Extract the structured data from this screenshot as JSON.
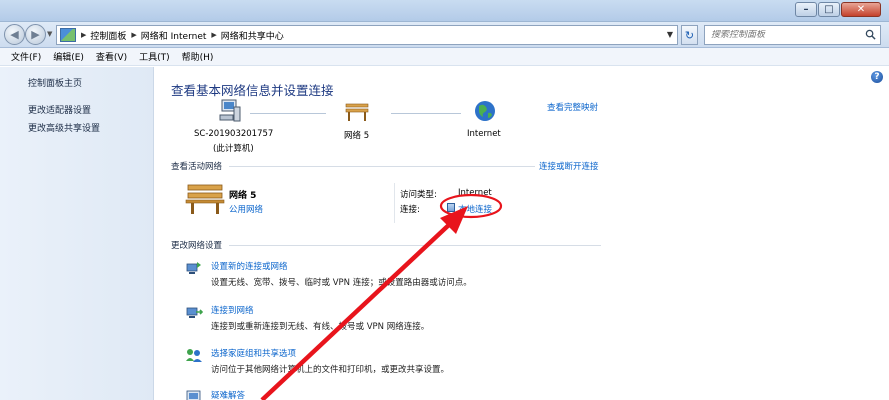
{
  "window": {
    "buttons": [
      "minimize",
      "maximize",
      "close"
    ]
  },
  "addressbar": {
    "crumbs": [
      "控制面板",
      "网络和 Internet",
      "网络和共享中心"
    ],
    "search_placeholder": "搜索控制面板"
  },
  "menu": [
    "文件(F)",
    "编辑(E)",
    "查看(V)",
    "工具(T)",
    "帮助(H)"
  ],
  "sidebar": {
    "home": "控制面板主页",
    "links": [
      "更改适配器设置",
      "更改高级共享设置"
    ]
  },
  "main": {
    "title": "查看基本网络信息并设置连接",
    "full_map_link": "查看完整映射",
    "map": {
      "computer_name": "SC-201903201757",
      "computer_sub": "(此计算机)",
      "network_name": "网络  5",
      "internet": "Internet"
    },
    "active_section": {
      "heading": "查看活动网络",
      "connect_link": "连接或断开连接",
      "network_name": "网络  5",
      "network_type": "公用网络",
      "access_type_label": "访问类型:",
      "access_type_value": "Internet",
      "connections_label": "连接:",
      "connection_link": "本地连接"
    },
    "change_section": {
      "heading": "更改网络设置",
      "tasks": [
        {
          "title": "设置新的连接或网络",
          "desc": "设置无线、宽带、拨号、临时或 VPN 连接；或设置路由器或访问点。"
        },
        {
          "title": "连接到网络",
          "desc": "连接到或重新连接到无线、有线、拨号或 VPN 网络连接。"
        },
        {
          "title": "选择家庭组和共享选项",
          "desc": "访问位于其他网络计算机上的文件和打印机，或更改共享设置。"
        },
        {
          "title": "疑难解答",
          "desc": ""
        }
      ]
    }
  },
  "colors": {
    "link": "#0c66cc",
    "title": "#1e3a82",
    "annotation": "#e8141c"
  },
  "icons": {
    "help": "?",
    "refresh": "↻",
    "back": "◀",
    "forward": "▶"
  }
}
